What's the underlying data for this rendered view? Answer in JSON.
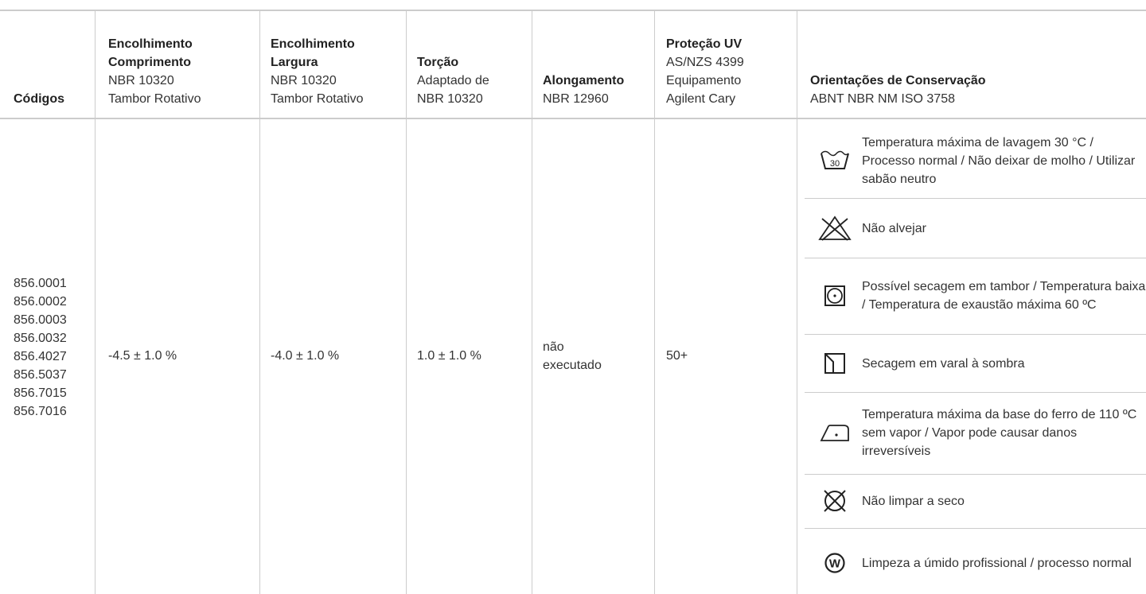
{
  "caption": "",
  "headers": {
    "codigos": {
      "bold": "Códigos",
      "sub": []
    },
    "enc_comp": {
      "bold": "Encolhimento Comprimento",
      "sub": [
        "NBR 10320",
        "Tambor Rotativo"
      ]
    },
    "enc_larg": {
      "bold": "Encolhimento Largura",
      "sub": [
        "NBR 10320",
        "Tambor Rotativo"
      ]
    },
    "torcao": {
      "bold": "Torção",
      "sub": [
        "Adaptado de",
        "NBR 10320"
      ]
    },
    "along": {
      "bold": "Alongamento",
      "sub": [
        "NBR 12960"
      ]
    },
    "uv": {
      "bold": "Proteção UV",
      "sub": [
        "AS/NZS 4399",
        "Equipamento",
        "Agilent Cary"
      ]
    },
    "cons": {
      "bold": "Orientações de Conservação",
      "sub": [
        "ABNT NBR NM ISO 3758"
      ]
    }
  },
  "row": {
    "codes": [
      "856.0001",
      "856.0002",
      "856.0003",
      "856.0032",
      "856.4027",
      "856.5037",
      "856.7015",
      "856.7016"
    ],
    "enc_comp": "-4.5 ± 1.0 %",
    "enc_larg": "-4.0 ± 1.0 %",
    "torcao": "1.0 ± 1.0 %",
    "along": "não executado",
    "uv": "50+"
  },
  "care": [
    {
      "icon": "wash-30-icon",
      "label": "30",
      "text": "Temperatura máxima de lavagem 30 °C / Processo normal / Não deixar de molho / Utilizar sabão neutro"
    },
    {
      "icon": "no-bleach-icon",
      "text": "Não alvejar"
    },
    {
      "icon": "tumble-dry-low-icon",
      "text": "Possível secagem em tambor / Temperatura baixa / Temperatura de exaustão máxima 60 ºC"
    },
    {
      "icon": "line-dry-shade-icon",
      "text": "Secagem em varal à sombra"
    },
    {
      "icon": "iron-low-icon",
      "text": "Temperatura máxima da base do ferro de 110 ºC sem vapor / Vapor pode causar danos irreversíveis"
    },
    {
      "icon": "no-dry-clean-icon",
      "text": "Não limpar a seco"
    },
    {
      "icon": "wet-clean-icon",
      "label": "W",
      "text": "Limpeza a úmido profissional / processo normal"
    }
  ]
}
